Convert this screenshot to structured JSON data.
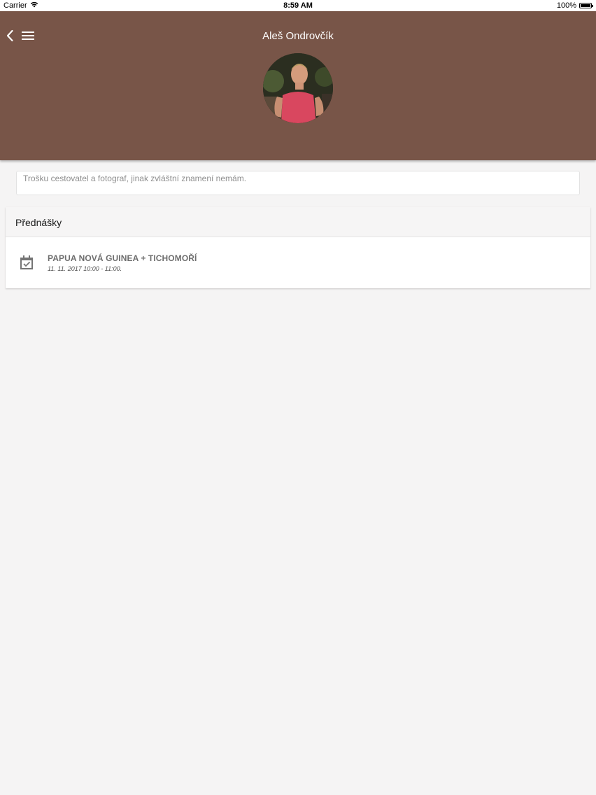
{
  "status_bar": {
    "carrier": "Carrier",
    "time": "8:59 AM",
    "battery": "100%"
  },
  "header": {
    "title": "Aleš Ondrovčík",
    "background_color": "#785548",
    "back_icon": "chevron-left-icon",
    "menu_icon": "hamburger-menu-icon"
  },
  "profile": {
    "bio": "Trošku cestovatel a fotograf, jinak zvláštní znamení nemám."
  },
  "lectures": {
    "title": "Přednášky",
    "items": [
      {
        "icon": "calendar-check-icon",
        "title": "PAPUA NOVÁ GUINEA + TICHOMOŘÍ",
        "time": "11. 11. 2017 10:00 - 11:00."
      }
    ]
  }
}
